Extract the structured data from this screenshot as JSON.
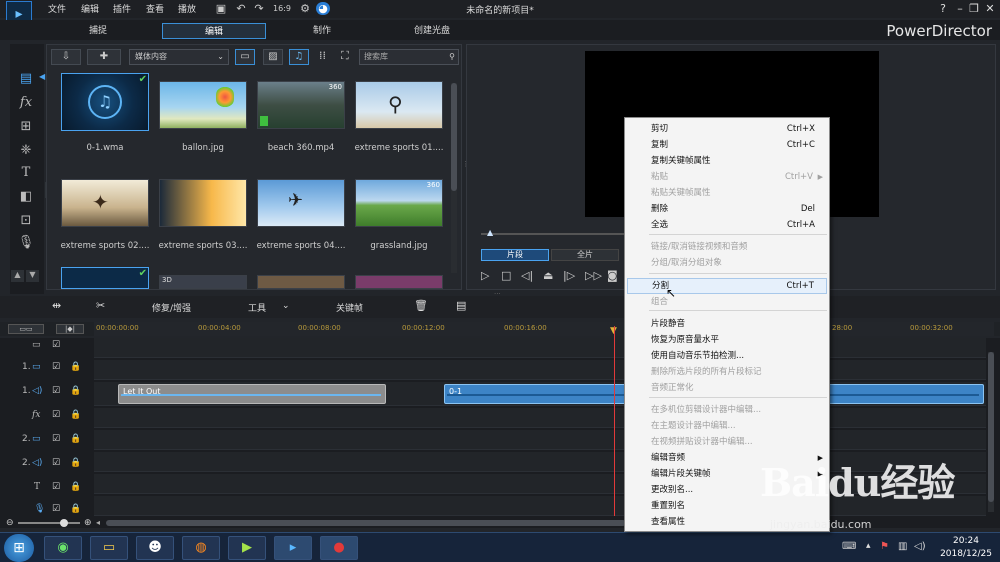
{
  "menu": [
    "文件",
    "编辑",
    "插件",
    "查看",
    "播放"
  ],
  "project_title": "未命名的新项目*",
  "window_controls": {
    "help": "?",
    "minimize": "–",
    "restore": "❐",
    "close": "✕"
  },
  "modes": [
    "捕捉",
    "编辑",
    "制作",
    "创建光盘"
  ],
  "brand": "PowerDirector",
  "library": {
    "media_select": "媒体内容",
    "search_placeholder": "搜索库",
    "items": [
      {
        "label": "0-1.wma",
        "kind": "audio",
        "check": true
      },
      {
        "label": "ballon.jpg",
        "kind": "image"
      },
      {
        "label": "beach 360.mp4",
        "kind": "video",
        "badge": "360"
      },
      {
        "label": "extreme sports 01....",
        "kind": "image"
      },
      {
        "label": "extreme sports 02....",
        "kind": "image"
      },
      {
        "label": "extreme sports 03....",
        "kind": "image"
      },
      {
        "label": "extreme sports 04....",
        "kind": "image"
      },
      {
        "label": "grassland.jpg",
        "kind": "image",
        "badge": "360"
      }
    ]
  },
  "preview": {
    "tab_clip": "片段",
    "tab_movie": "全片"
  },
  "timeline_tools": {
    "fix": "修复/增强",
    "tools": "工具",
    "keyframe": "关键帧"
  },
  "ruler": [
    "00:00:00:00",
    "00:00:04:00",
    "00:00:08:00",
    "00:00:12:00",
    "00:00:16:00",
    "28:00",
    "00:00:32:00"
  ],
  "tracks": [
    {
      "id": "",
      "type": "master"
    },
    {
      "id": "1.",
      "type": "video"
    },
    {
      "id": "1.",
      "type": "audio"
    },
    {
      "id": "",
      "type": "fx",
      "label": "fx"
    },
    {
      "id": "2.",
      "type": "video"
    },
    {
      "id": "2.",
      "type": "audio"
    },
    {
      "id": "",
      "type": "title",
      "label": "T"
    },
    {
      "id": "",
      "type": "voice"
    }
  ],
  "clips": {
    "clip1": "Let It Out",
    "clip2": "0-1"
  },
  "context_menu": [
    {
      "label": "剪切",
      "shortcut": "Ctrl+X",
      "enabled": true
    },
    {
      "label": "复制",
      "shortcut": "Ctrl+C",
      "enabled": true
    },
    {
      "label": "复制关键帧属性",
      "shortcut": "",
      "enabled": true
    },
    {
      "label": "粘贴",
      "shortcut": "Ctrl+V",
      "enabled": false,
      "arrow": true
    },
    {
      "label": "粘贴关键帧属性",
      "shortcut": "",
      "enabled": false
    },
    {
      "label": "删除",
      "shortcut": "Del",
      "enabled": true
    },
    {
      "label": "全选",
      "shortcut": "Ctrl+A",
      "enabled": true
    },
    {
      "label": "链接/取消链接视频和音频",
      "shortcut": "",
      "enabled": false
    },
    {
      "label": "分组/取消分组对象",
      "shortcut": "",
      "enabled": false
    },
    {
      "label": "分割",
      "shortcut": "Ctrl+T",
      "enabled": true,
      "highlight": true
    },
    {
      "label": "组合",
      "shortcut": "",
      "enabled": false
    },
    {
      "label": "片段静音",
      "shortcut": "",
      "enabled": true
    },
    {
      "label": "恢复为原音量水平",
      "shortcut": "",
      "enabled": true
    },
    {
      "label": "使用自动音乐节拍检测...",
      "shortcut": "",
      "enabled": true
    },
    {
      "label": "删除所选片段的所有片段标记",
      "shortcut": "",
      "enabled": false
    },
    {
      "label": "音频正常化",
      "shortcut": "",
      "enabled": false
    },
    {
      "label": "在多机位剪辑设计器中编辑...",
      "shortcut": "",
      "enabled": false
    },
    {
      "label": "在主题设计器中编辑...",
      "shortcut": "",
      "enabled": false
    },
    {
      "label": "在视频拼贴设计器中编辑...",
      "shortcut": "",
      "enabled": false
    },
    {
      "label": "编辑音频",
      "shortcut": "",
      "enabled": true,
      "arrow": true
    },
    {
      "label": "编辑片段关键帧",
      "shortcut": "",
      "enabled": true,
      "arrow": true
    },
    {
      "label": "更改别名...",
      "shortcut": "",
      "enabled": true
    },
    {
      "label": "重置别名",
      "shortcut": "",
      "enabled": true
    },
    {
      "label": "查看属性",
      "shortcut": "",
      "enabled": true
    }
  ],
  "clock": {
    "time": "20:24",
    "date": "2018/12/25"
  },
  "watermark": {
    "text": "Baidu经验",
    "url": "jingyan.baidu.com"
  }
}
